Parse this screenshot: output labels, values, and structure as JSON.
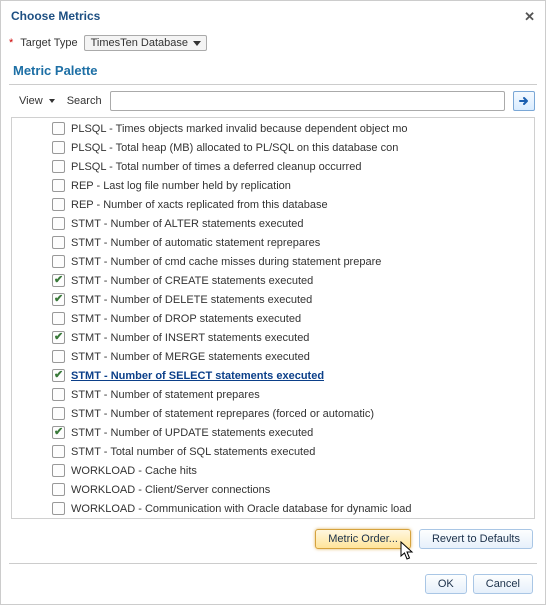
{
  "dialog": {
    "title": "Choose Metrics",
    "target_label": "Target Type",
    "target_value": "TimesTen Database"
  },
  "palette": {
    "title": "Metric Palette"
  },
  "toolbar": {
    "view_label": "View",
    "search_label": "Search",
    "search_value": ""
  },
  "metrics": [
    {
      "label": "PLSQL - Times objects marked invalid because dependent object mo",
      "checked": false
    },
    {
      "label": "PLSQL - Total heap (MB) allocated to PL/SQL on this database con",
      "checked": false
    },
    {
      "label": "PLSQL - Total number of times a deferred cleanup occurred",
      "checked": false
    },
    {
      "label": "REP - Last log file number held by replication",
      "checked": false
    },
    {
      "label": "REP - Number of xacts replicated from this database",
      "checked": false
    },
    {
      "label": "STMT - Number of ALTER statements executed",
      "checked": false
    },
    {
      "label": "STMT - Number of automatic statement reprepares",
      "checked": false
    },
    {
      "label": "STMT - Number of cmd cache misses during statement prepare",
      "checked": false
    },
    {
      "label": "STMT - Number of CREATE statements executed",
      "checked": true
    },
    {
      "label": "STMT - Number of DELETE statements executed",
      "checked": true
    },
    {
      "label": "STMT - Number of DROP statements executed",
      "checked": false
    },
    {
      "label": "STMT - Number of INSERT statements executed",
      "checked": true
    },
    {
      "label": "STMT - Number of MERGE statements executed",
      "checked": false
    },
    {
      "label": "STMT - Number of SELECT statements executed",
      "checked": true,
      "highlight": true
    },
    {
      "label": "STMT - Number of statement prepares",
      "checked": false
    },
    {
      "label": "STMT - Number of statement reprepares (forced or automatic)",
      "checked": false
    },
    {
      "label": "STMT - Number of UPDATE statements executed",
      "checked": true
    },
    {
      "label": "STMT - Total number of SQL statements executed",
      "checked": false
    },
    {
      "label": "WORKLOAD - Cache hits",
      "checked": false
    },
    {
      "label": "WORKLOAD - Client/Server connections",
      "checked": false
    },
    {
      "label": "WORKLOAD - Communication with Oracle database for dynamic load",
      "checked": false
    }
  ],
  "buttons": {
    "metric_order": "Metric Order...",
    "revert": "Revert to Defaults",
    "ok": "OK",
    "cancel": "Cancel"
  }
}
